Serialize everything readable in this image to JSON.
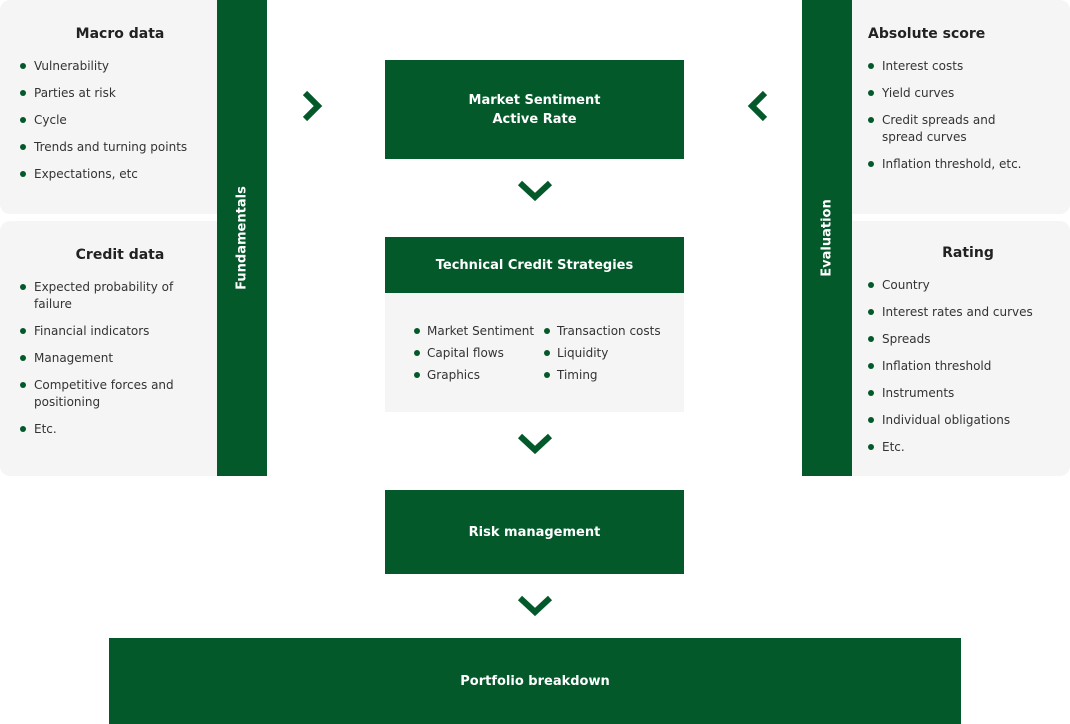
{
  "colors": {
    "brand_green": "#03592a",
    "panel_bg": "#f5f5f5",
    "text": "#333333"
  },
  "left": {
    "macro": {
      "title": "Macro data",
      "items": [
        "Vulnerability",
        "Parties at risk",
        "Cycle",
        "Trends and turning points",
        "Expectations, etc"
      ]
    },
    "credit": {
      "title": "Credit data",
      "items": [
        "Expected probability of failure",
        "Financial indicators",
        "Management",
        "Competitive forces and positioning",
        "Etc."
      ]
    },
    "bar_label": "Fundamentals"
  },
  "right": {
    "absolute": {
      "title": "Absolute score",
      "items": [
        "Interest costs",
        "Yield curves",
        "Credit spreads and spread curves",
        "Inflation threshold, etc."
      ]
    },
    "rating": {
      "title": "Rating",
      "items": [
        "Country",
        "Interest rates and curves",
        "Spreads",
        "Inflation threshold",
        "Instruments",
        "Individual obligations",
        "Etc."
      ]
    },
    "bar_label": "Evaluation"
  },
  "center": {
    "sentiment": {
      "line1": "Market Sentiment",
      "line2": "Active Rate"
    },
    "strategies": {
      "title": "Technical Credit Strategies",
      "col1": [
        "Market Sentiment",
        "Capital flows",
        "Graphics"
      ],
      "col2": [
        "Transaction costs",
        "Liquidity",
        "Timing"
      ]
    },
    "risk": "Risk management",
    "portfolio": "Portfolio breakdown"
  },
  "icons": {
    "arrow_right": "chevron-right-icon",
    "arrow_left": "chevron-left-icon",
    "arrow_down": "chevron-down-icon"
  }
}
